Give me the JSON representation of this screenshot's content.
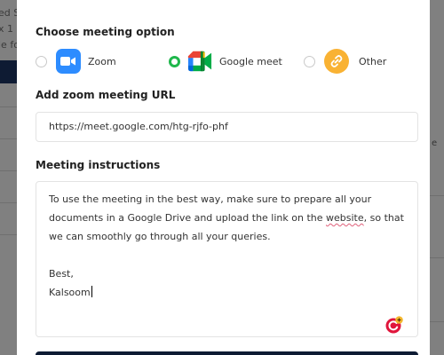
{
  "background": {
    "left_fragments": [
      "ed S",
      "x 1",
      "le fo"
    ]
  },
  "modal": {
    "meeting_option": {
      "title": "Choose meeting option",
      "options": [
        {
          "label": "Zoom",
          "icon": "zoom-icon",
          "selected": false,
          "color": "#2d8cff"
        },
        {
          "label": "Google meet",
          "icon": "google-meet-icon",
          "selected": true,
          "color": "#00832d"
        },
        {
          "label": "Other",
          "icon": "link-icon",
          "selected": false,
          "color": "#f9b233"
        }
      ]
    },
    "url": {
      "title": "Add zoom meeting URL",
      "value": "https://meet.google.com/htg-rjfo-phf"
    },
    "instructions": {
      "title": "Meeting instructions",
      "line1": "To use the meeting in the best way, make sure to prepare all your",
      "line2a": "documents in a Google Drive and upload the link on the ",
      "line2_misspelled": "website",
      "line2b": ", so that",
      "line3": "we can smoothly go through all your queries.",
      "line4": "Best,",
      "line5": "Kalsoom"
    }
  },
  "colors": {
    "accent_selected": "#1fb74c",
    "primary_button": "#0e1b33",
    "overlay": "#7f7f80"
  }
}
